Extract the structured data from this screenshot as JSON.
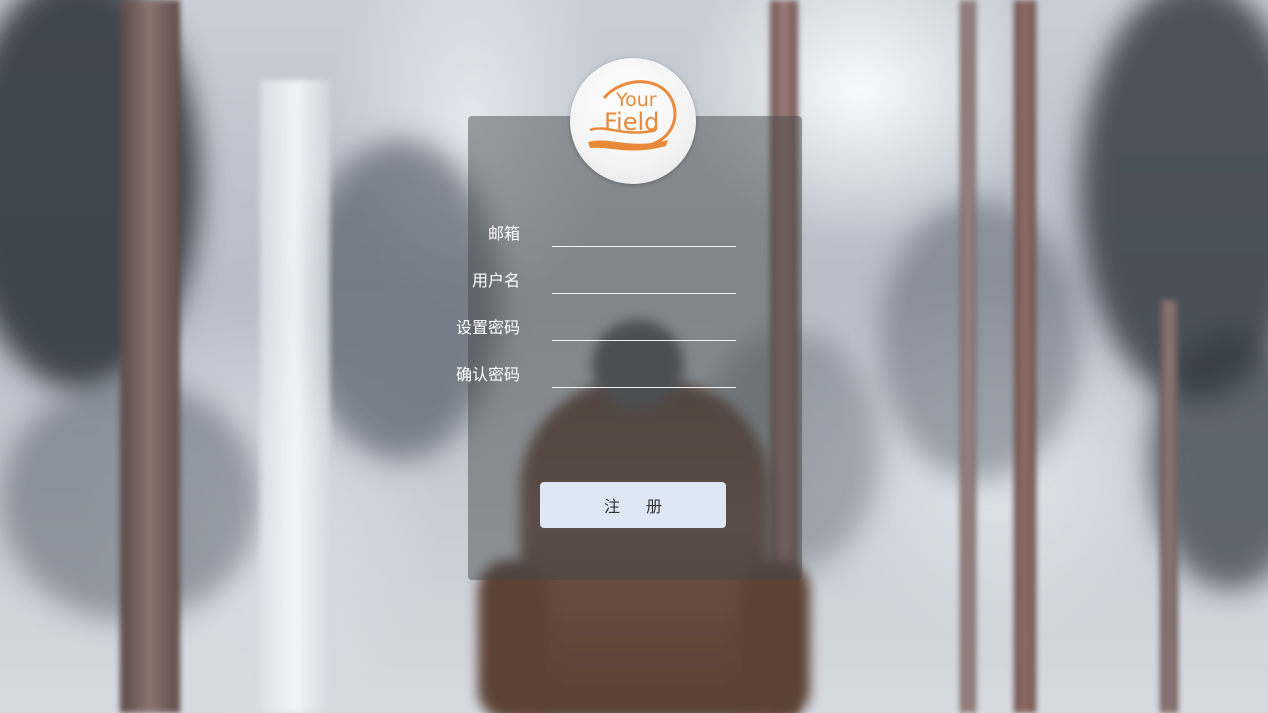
{
  "logo": {
    "line1": "Your",
    "line2": "Field",
    "color": "#e98a3a"
  },
  "form": {
    "fields": [
      {
        "label": "邮箱",
        "value": "",
        "placeholder": ""
      },
      {
        "label": "用户名",
        "value": "",
        "placeholder": ""
      },
      {
        "label": "设置密码",
        "value": "",
        "placeholder": ""
      },
      {
        "label": "确认密码",
        "value": "",
        "placeholder": ""
      }
    ],
    "submit_label": "注册"
  },
  "colors": {
    "panel_overlay": "#464848",
    "button_bg": "#dde8f4",
    "accent": "#e98a3a"
  }
}
